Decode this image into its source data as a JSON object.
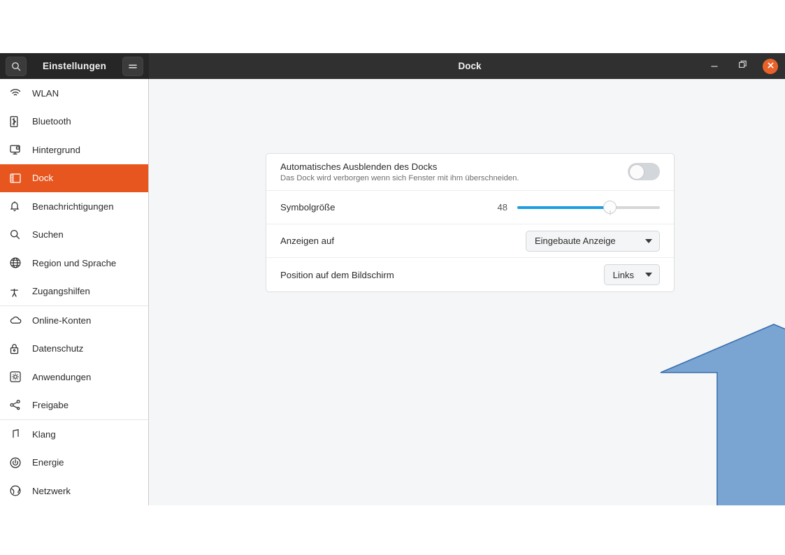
{
  "window": {
    "app_title": "Einstellungen",
    "page_title": "Dock",
    "search_icon": "search-icon",
    "menu_icon": "hamburger-menu-icon",
    "minimize_label": "–",
    "maximize_label": "Maximieren",
    "close_label": "×",
    "accent_color": "#e8561f",
    "close_button_color": "#e8622a",
    "titlebar_color": "#303030"
  },
  "sidebar": {
    "items": [
      {
        "label": "WLAN",
        "icon": "wifi-icon",
        "selected": false,
        "separator_after": false
      },
      {
        "label": "Bluetooth",
        "icon": "bluetooth-icon",
        "selected": false,
        "separator_after": false
      },
      {
        "label": "Hintergrund",
        "icon": "wallpaper-icon",
        "selected": false,
        "separator_after": false
      },
      {
        "label": "Dock",
        "icon": "dock-icon",
        "selected": true,
        "separator_after": false
      },
      {
        "label": "Benachrichtigungen",
        "icon": "bell-icon",
        "selected": false,
        "separator_after": false
      },
      {
        "label": "Suchen",
        "icon": "search-icon",
        "selected": false,
        "separator_after": false
      },
      {
        "label": "Region und Sprache",
        "icon": "globe-icon",
        "selected": false,
        "separator_after": false
      },
      {
        "label": "Zugangshilfen",
        "icon": "accessibility-icon",
        "selected": false,
        "separator_after": true
      },
      {
        "label": "Online-Konten",
        "icon": "cloud-icon",
        "selected": false,
        "separator_after": false
      },
      {
        "label": "Datenschutz",
        "icon": "lock-icon",
        "selected": false,
        "separator_after": false
      },
      {
        "label": "Anwendungen",
        "icon": "gear-box-icon",
        "selected": false,
        "separator_after": false
      },
      {
        "label": "Freigabe",
        "icon": "share-icon",
        "selected": false,
        "separator_after": true
      },
      {
        "label": "Klang",
        "icon": "music-note-icon",
        "selected": false,
        "separator_after": false
      },
      {
        "label": "Energie",
        "icon": "power-icon",
        "selected": false,
        "separator_after": false
      },
      {
        "label": "Netzwerk",
        "icon": "network-globe-icon",
        "selected": false,
        "separator_after": false
      }
    ]
  },
  "settings": {
    "auto_hide": {
      "label": "Automatisches Ausblenden des Docks",
      "description": "Das Dock wird verborgen wenn sich Fenster mit ihm überschneiden.",
      "toggle_state": "off"
    },
    "icon_size": {
      "label": "Symbolgröße",
      "value": "48",
      "slider_percent": 65,
      "fill_color": "#1f9ede"
    },
    "show_on": {
      "label": "Anzeigen auf",
      "value": "Eingebaute Anzeige"
    },
    "position": {
      "label": "Position auf dem Bildschirm",
      "value": "Links"
    }
  },
  "annotation": {
    "arrow": {
      "name": "up-arrow-annotation",
      "fill_color": "#7AA5D2",
      "stroke_color": "#3A6FAF",
      "direction": "up"
    }
  }
}
